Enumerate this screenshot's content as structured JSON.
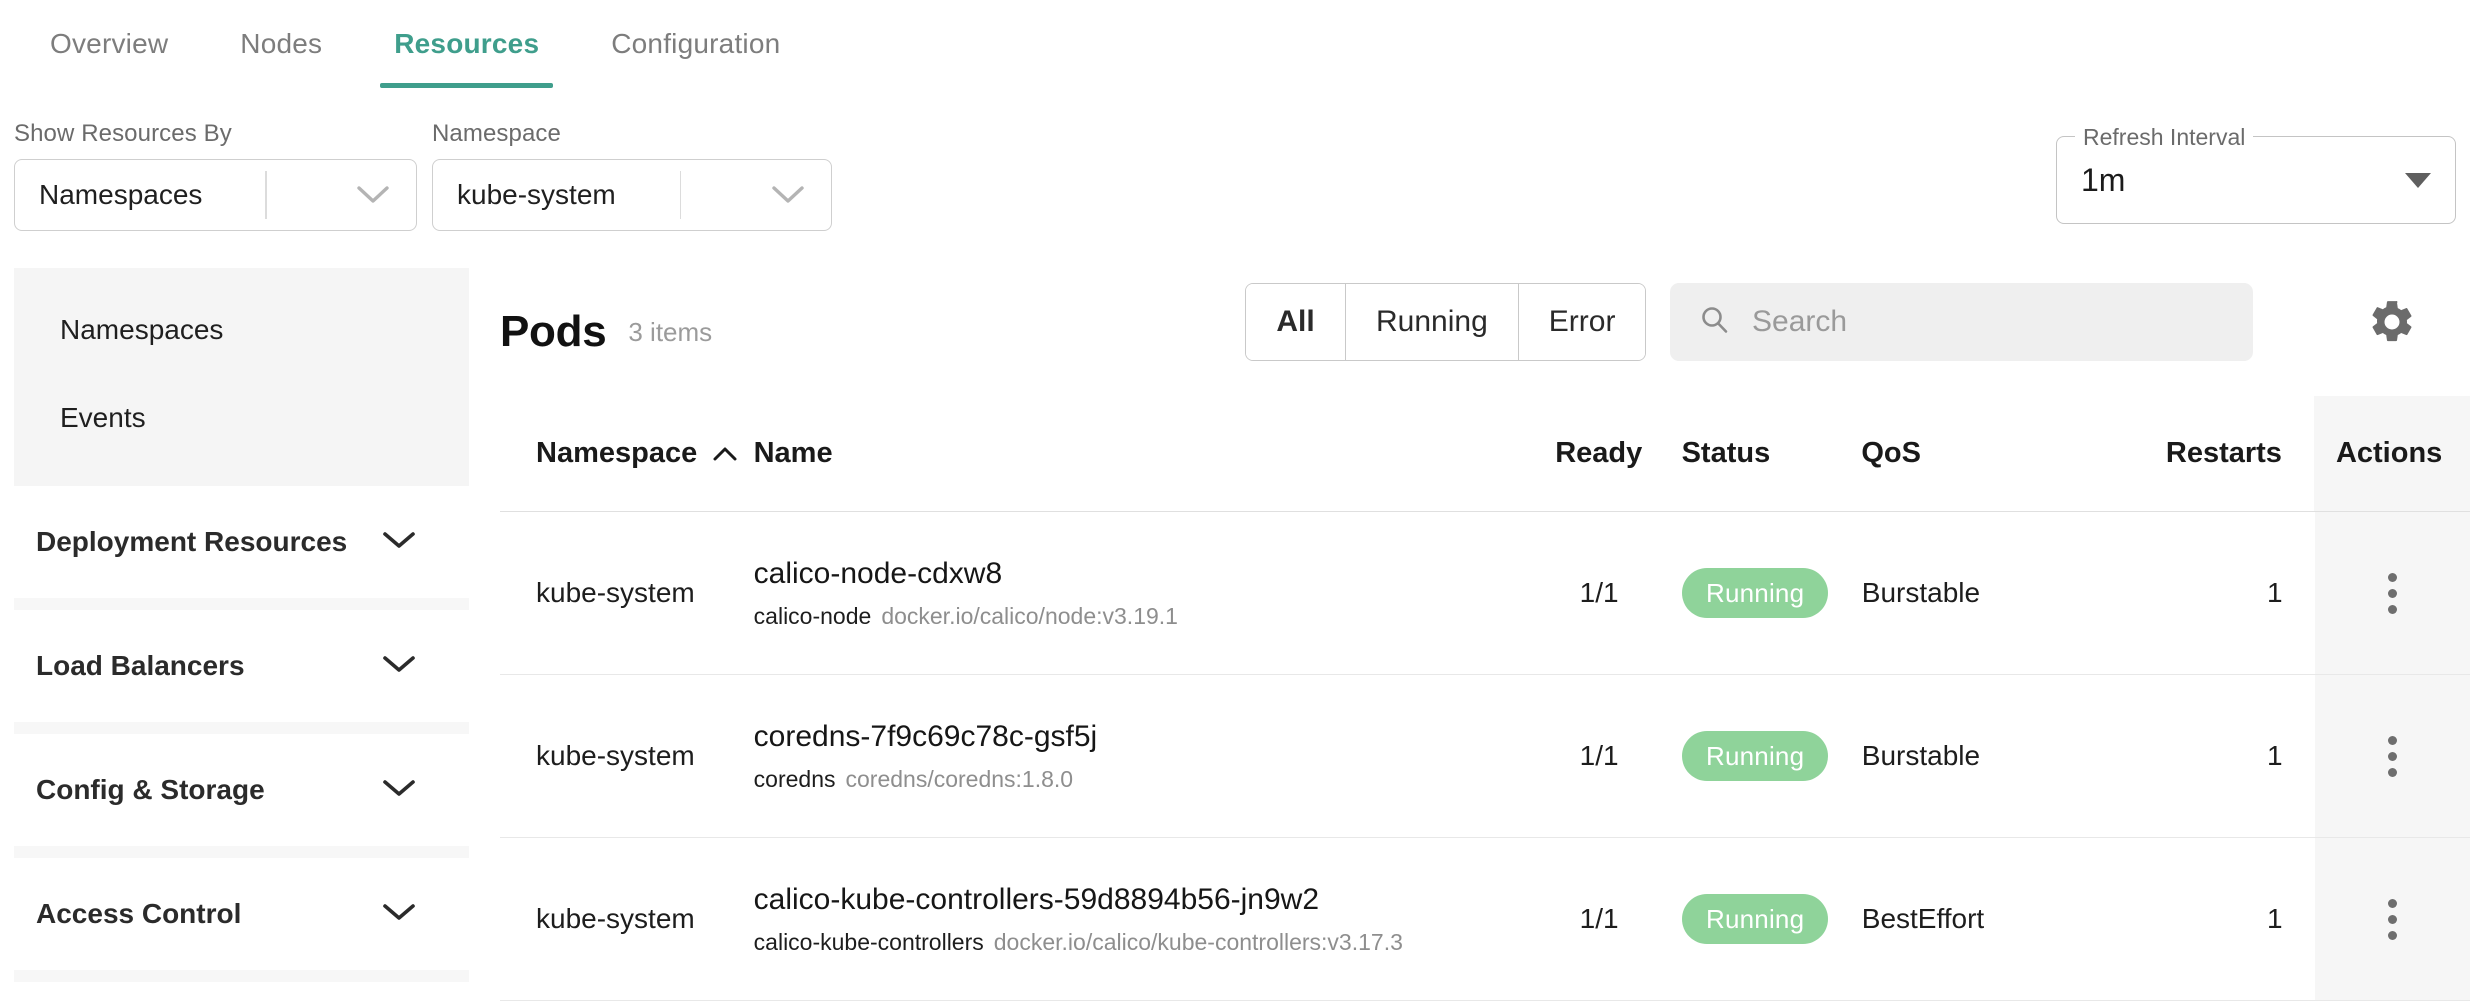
{
  "tabs": [
    {
      "label": "Overview",
      "active": false
    },
    {
      "label": "Nodes",
      "active": false
    },
    {
      "label": "Resources",
      "active": true
    },
    {
      "label": "Configuration",
      "active": false
    }
  ],
  "filters": {
    "show_by": {
      "label": "Show Resources By",
      "value": "Namespaces"
    },
    "namespace": {
      "label": "Namespace",
      "value": "kube-system"
    },
    "refresh": {
      "label": "Refresh Interval",
      "value": "1m"
    }
  },
  "sidebar": {
    "active_items": [
      {
        "label": "Namespaces"
      },
      {
        "label": "Events"
      }
    ],
    "sections": [
      {
        "label": "Deployment Resources"
      },
      {
        "label": "Load Balancers"
      },
      {
        "label": "Config & Storage"
      },
      {
        "label": "Access Control"
      }
    ]
  },
  "content": {
    "title": "Pods",
    "count": "3 items",
    "segments": [
      {
        "label": "All",
        "active": true
      },
      {
        "label": "Running",
        "active": false
      },
      {
        "label": "Error",
        "active": false
      }
    ],
    "search": {
      "value": "",
      "placeholder": "Search"
    },
    "settings_icon": "gear-icon"
  },
  "table": {
    "columns": [
      {
        "key": "namespace",
        "label": "Namespace",
        "sorted": "asc"
      },
      {
        "key": "name",
        "label": "Name"
      },
      {
        "key": "ready",
        "label": "Ready"
      },
      {
        "key": "status",
        "label": "Status"
      },
      {
        "key": "qos",
        "label": "QoS"
      },
      {
        "key": "restarts",
        "label": "Restarts"
      },
      {
        "key": "actions",
        "label": "Actions"
      }
    ],
    "rows": [
      {
        "namespace": "kube-system",
        "name": "calico-node-cdxw8",
        "container": "calico-node",
        "image": "docker.io/calico/node:v3.19.1",
        "ready": "1/1",
        "status": "Running",
        "qos": "Burstable",
        "restarts": "1"
      },
      {
        "namespace": "kube-system",
        "name": "coredns-7f9c69c78c-gsf5j",
        "container": "coredns",
        "image": "coredns/coredns:1.8.0",
        "ready": "1/1",
        "status": "Running",
        "qos": "Burstable",
        "restarts": "1"
      },
      {
        "namespace": "kube-system",
        "name": "calico-kube-controllers-59d8894b56-jn9w2",
        "container": "calico-kube-controllers",
        "image": "docker.io/calico/kube-controllers:v3.17.3",
        "ready": "1/1",
        "status": "Running",
        "qos": "BestEffort",
        "restarts": "1"
      }
    ]
  },
  "colors": {
    "accent": "#3f9e8c",
    "status_running_bg": "#8fd39a",
    "status_running_text": "#ffffff",
    "sidebar_active_bg": "#f5f5f5",
    "search_bg": "#efefef"
  }
}
